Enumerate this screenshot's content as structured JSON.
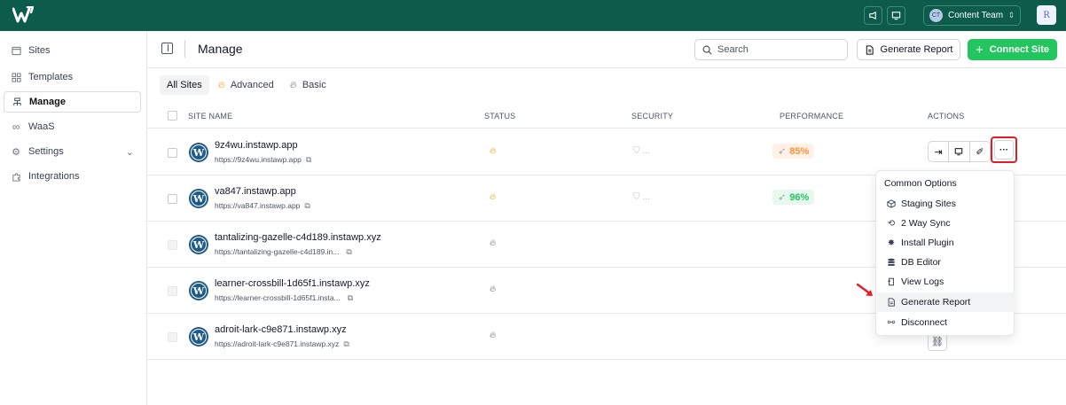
{
  "topbar": {
    "team_initials": "CT",
    "team_name": "Content Team",
    "user_initial": "R"
  },
  "sidebar": {
    "items": [
      {
        "label": "Sites",
        "icon": "browser-icon"
      },
      {
        "label": "Templates",
        "icon": "grid-icon"
      },
      {
        "label": "Manage",
        "icon": "tree-icon",
        "active": true
      },
      {
        "label": "WaaS",
        "icon": "infinity-icon"
      },
      {
        "label": "Settings",
        "icon": "gear-icon"
      },
      {
        "label": "Integrations",
        "icon": "puzzle-icon"
      }
    ]
  },
  "header": {
    "title": "Manage",
    "search_placeholder": "Search",
    "generate_report": "Generate Report",
    "connect_site": "Connect Site"
  },
  "filters": {
    "all": "All Sites",
    "advanced": "Advanced",
    "basic": "Basic"
  },
  "table": {
    "headers": {
      "site_name": "SITE NAME",
      "status": "STATUS",
      "security": "SECURITY",
      "performance": "PERFORMANCE",
      "actions": "ACTIONS"
    },
    "rows": [
      {
        "name": "9z4wu.instawp.app",
        "url": "https://9z4wu.instawp.app",
        "security": "...",
        "performance": "85%"
      },
      {
        "name": "va847.instawp.app",
        "url": "https://va847.instawp.app",
        "security": "...",
        "performance": "96%"
      },
      {
        "name": "tantalizing-gazelle-c4d189.instawp.xyz",
        "url": "https://tantalizing-gazelle-c4d189.in...",
        "security": "",
        "performance": ""
      },
      {
        "name": "learner-crossbill-1d65f1.instawp.xyz",
        "url": "https://learner-crossbill-1d65f1.insta...",
        "security": "",
        "performance": ""
      },
      {
        "name": "adroit-lark-c9e871.instawp.xyz",
        "url": "https://adroit-lark-c9e871.instawp.xyz",
        "security": "",
        "performance": ""
      }
    ]
  },
  "menu": {
    "heading": "Common Options",
    "items": [
      "Staging Sites",
      "2 Way Sync",
      "Install Plugin",
      "DB Editor",
      "View Logs",
      "Generate Report",
      "Disconnect"
    ]
  },
  "colors": {
    "topbar": "#0d5c4b",
    "primary": "#22c55e",
    "highlight_border": "#e11d2a",
    "perf_orange": "#fb923c",
    "perf_green": "#22c55e"
  }
}
